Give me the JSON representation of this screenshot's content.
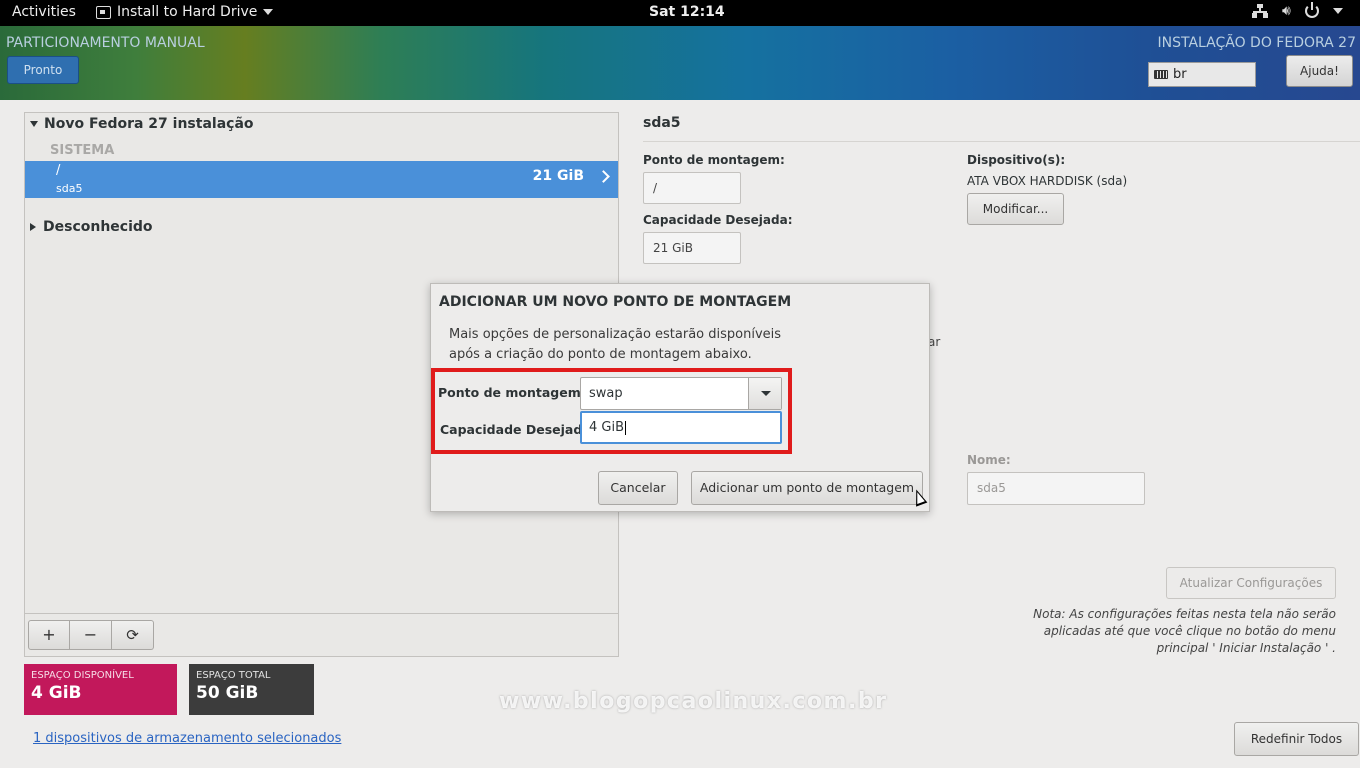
{
  "topbar": {
    "activities": "Activities",
    "app_menu": "Install to Hard Drive",
    "clock": "Sat 12:14"
  },
  "header": {
    "left_title": "PARTICIONAMENTO MANUAL",
    "done_label": "Pronto",
    "right_title": "INSTALAÇÃO DO FEDORA 27",
    "keyboard_layout": "br",
    "help_label": "Ajuda!"
  },
  "left_pane": {
    "group_title": "Novo Fedora 27 instalação",
    "section_label": "SISTEMA",
    "selected_row": {
      "mount": "/",
      "device": "sda5",
      "size": "21 GiB"
    },
    "unknown_group": "Desconhecido",
    "toolbar": {
      "add": "+",
      "remove": "−",
      "refresh": "⟳"
    }
  },
  "space": {
    "available_label": "ESPAÇO DISPONÍVEL",
    "available_value": "4 GiB",
    "total_label": "ESPAÇO TOTAL",
    "total_value": "50 GiB",
    "storage_link": "1 dispositivos de armazenamento selecionados"
  },
  "right_pane": {
    "title": "sda5",
    "mount_label": "Ponto de montagem:",
    "mount_value": "/",
    "capacity_label": "Capacidade Desejada:",
    "capacity_value": "21 GiB",
    "devices_label": "Dispositivo(s):",
    "device_name": "ATA VBOX HARDDISK (sda)",
    "modify_label": "Modificar...",
    "hidden_fragment": "ar",
    "name_label": "Nome:",
    "name_value": "sda5",
    "update_label": "Atualizar Configurações",
    "note": "Nota: As configurações feitas nesta tela não serão aplicadas até que você clique no botão do menu principal ' Iniciar Instalação ' .",
    "reset_label": "Redefinir Todos"
  },
  "dialog": {
    "title": "ADICIONAR UM NOVO PONTO DE MONTAGEM",
    "description": "Mais opções de personalização estarão disponíveis após a criação do ponto de montagem abaixo.",
    "mount_label": "Ponto de montagem",
    "mount_value": "swap",
    "capacity_label": "Capacidade Desejada:",
    "capacity_value": "4 GiB",
    "cancel_label": "Cancelar",
    "add_label": "Adicionar um ponto de montagem",
    "highlight_color": "#e01b1b"
  },
  "watermark": "www.blogopcaolinux.com.br",
  "colors": {
    "selection": "#4a90d9",
    "available_space": "#c2185b",
    "total_space": "#3c3c3c"
  }
}
